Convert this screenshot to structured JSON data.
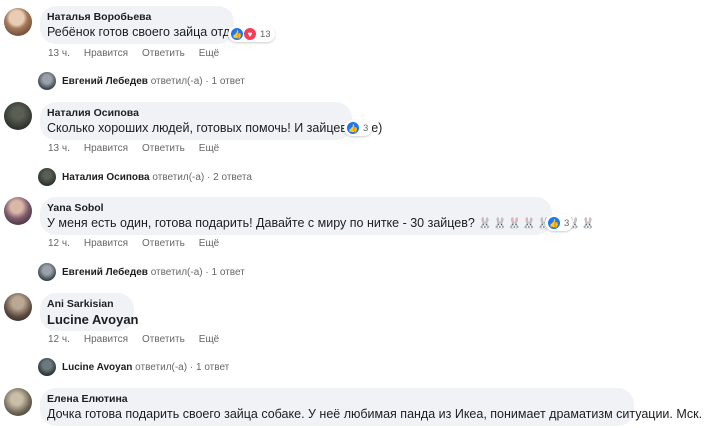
{
  "comments": [
    {
      "author": "Наталья Воробьева",
      "text": "Ребёнок готов своего зайца отдать",
      "reactions": {
        "types": [
          "like-icon",
          "love-icon"
        ],
        "count": "13"
      },
      "time": "13 ч.",
      "actions": [
        "Нравится",
        "Ответить",
        "Ещё"
      ],
      "reply": {
        "name": "Евгений Лебедев",
        "verb": "ответил(-а)",
        "sep": "·",
        "count": "1 ответ"
      }
    },
    {
      "author": "Наталия Осипова",
      "text": "Сколько хороших людей, готовых помочь! И зайцев тоже)",
      "reactions": {
        "types": [
          "like-icon"
        ],
        "count": "3"
      },
      "time": "13 ч.",
      "actions": [
        "Нравится",
        "Ответить",
        "Ещё"
      ],
      "reply": {
        "name": "Наталия Осипова",
        "verb": "ответил(-а)",
        "sep": "·",
        "count": "2 ответа"
      }
    },
    {
      "author": "Yana Sobol",
      "text": "У меня есть один, готова подарить! Давайте с миру по нитке - 30 зайцев?",
      "emoji": "🐰🐰🐰🐰🐰🐰🐰🐰",
      "reactions": {
        "types": [
          "like-icon"
        ],
        "count": "3"
      },
      "time": "12 ч.",
      "actions": [
        "Нравится",
        "Ответить",
        "Ещё"
      ],
      "reply": {
        "name": "Евгений Лебедев",
        "verb": "ответил(-а)",
        "sep": "·",
        "count": "1 ответ"
      }
    },
    {
      "author": "Ani Sarkisian",
      "text": "Lucine Avoyan",
      "time": "12 ч.",
      "actions": [
        "Нравится",
        "Ответить",
        "Ещё"
      ],
      "reply": {
        "name": "Lucine Avoyan",
        "verb": "ответил(-а)",
        "sep": "·",
        "count": "1 ответ"
      }
    },
    {
      "author": "Елена Елютина",
      "text": "Дочка готова подарить своего зайца собаке. У неё любимая панда из Икеа, понимает драматизм ситуации. Мск."
    }
  ],
  "colors": {
    "bubble": "#f0f2f5",
    "meta": "#65676b",
    "like": "#1877f2",
    "love": "#f33e58"
  }
}
